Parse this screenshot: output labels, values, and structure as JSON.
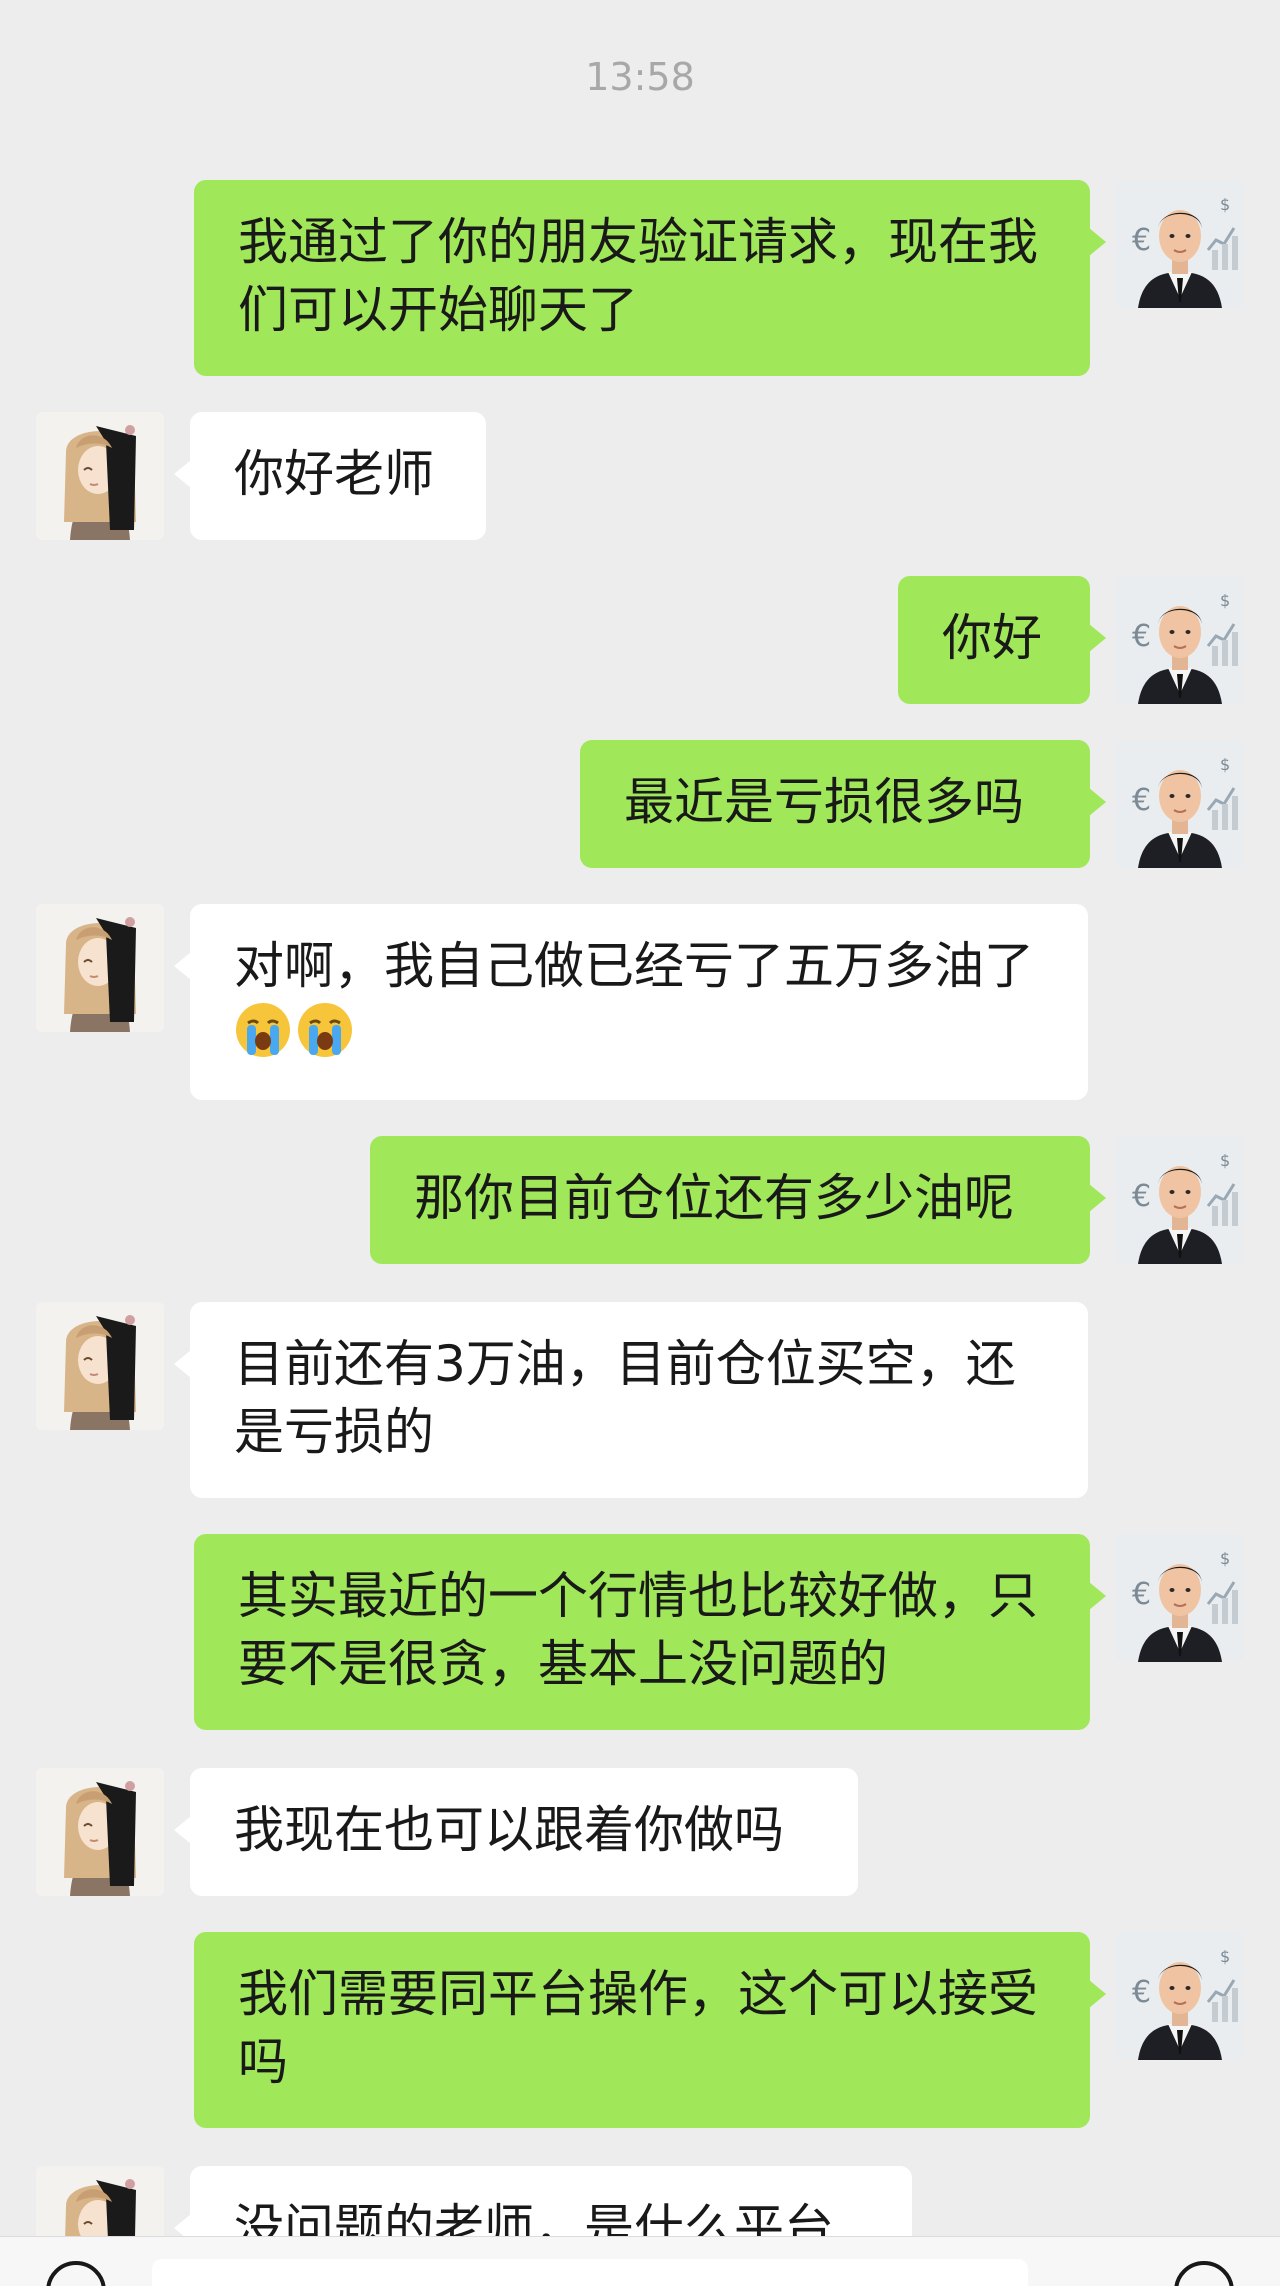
{
  "timestamp": "13:58",
  "messages": [
    {
      "side": "out",
      "text": "我通过了你的朋友验证请求，现在我们可以开始聊天了"
    },
    {
      "side": "in",
      "text": "你好老师"
    },
    {
      "side": "out",
      "text": "你好"
    },
    {
      "side": "out",
      "text": "最近是亏损很多吗"
    },
    {
      "side": "in",
      "text": "对啊，我自己做已经亏了五万多油了",
      "emojis": [
        "loudly-crying-face-emoji",
        "loudly-crying-face-emoji"
      ]
    },
    {
      "side": "out",
      "text": "那你目前仓位还有多少油呢"
    },
    {
      "side": "in",
      "text": "目前还有3万油，目前仓位买空，还是亏损的"
    },
    {
      "side": "out",
      "text": "其实最近的一个行情也比较好做，只要不是很贪，基本上没问题的"
    },
    {
      "side": "in",
      "text": "我现在也可以跟着你做吗"
    },
    {
      "side": "out",
      "text": "我们需要同平台操作，这个可以接受吗"
    },
    {
      "side": "in",
      "text": "没问题的老师，是什么平台"
    }
  ],
  "colors": {
    "background": "#ededed",
    "outgoing_bubble": "#a0e75a",
    "incoming_bubble": "#ffffff",
    "timestamp": "#a8a8a8"
  },
  "icons": {
    "self_avatar": "businessman-avatar",
    "contact_avatar": "anime-girl-avatar",
    "voice": "voice-icon",
    "plus": "plus-icon"
  }
}
